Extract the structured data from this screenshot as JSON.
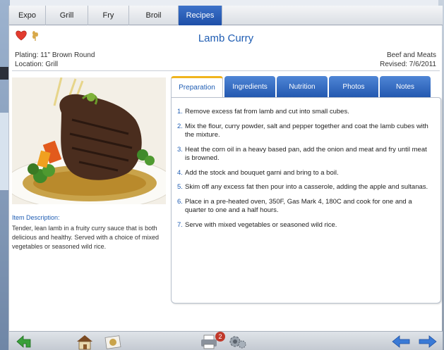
{
  "top_tabs": [
    {
      "label": "Expo"
    },
    {
      "label": "Grill"
    },
    {
      "label": "Fry"
    },
    {
      "label": "Broil"
    },
    {
      "label": "Recipes",
      "active": true
    }
  ],
  "recipe": {
    "title": "Lamb Curry",
    "plating": "Plating: 11\" Brown Round",
    "location": "Location: Grill",
    "category": "Beef and Meats",
    "revised": "Revised: 7/6/2011",
    "description_heading": "Item Description:",
    "description": "Tender, lean lamb in a fruity curry sauce that is both delicious and healthy. Served with a choice of mixed vegetables or seasoned wild rice."
  },
  "content_tabs": [
    {
      "label": "Preparation",
      "active": true
    },
    {
      "label": "Ingredients"
    },
    {
      "label": "Nutrition"
    },
    {
      "label": "Photos"
    },
    {
      "label": "Notes"
    }
  ],
  "steps": [
    {
      "num": "1.",
      "text": "Remove excess fat from lamb and cut into small cubes."
    },
    {
      "num": "2.",
      "text": "Mix the flour, curry powder, salt and pepper together  and coat the lamb cubes with the mixture."
    },
    {
      "num": "3.",
      "text": "Heat the corn oil in a heavy based pan, add the onion and meat and fry until meat is browned."
    },
    {
      "num": "4.",
      "text": "Add the stock and bouquet garni and bring to a boil."
    },
    {
      "num": "5.",
      "text": "Skim off any excess fat then pour into a casserole, adding the apple and sultanas."
    },
    {
      "num": "6.",
      "text": "Place in a pre-heated oven, 350F, Gas Mark 4, 180C and cook for one and a quarter to one and a half hours."
    },
    {
      "num": "7.",
      "text": "Serve with mixed vegetables or seasoned wild rice."
    }
  ],
  "toolbar": {
    "print_badge": "2"
  },
  "icons": {
    "favorite": "heart-icon",
    "dietary": "wheat-icon",
    "back": "return-arrow-icon",
    "home": "house-icon",
    "photo": "photo-icon",
    "print": "printer-icon",
    "settings": "gear-icon",
    "prev": "left-arrow-icon",
    "next": "right-arrow-icon"
  },
  "colors": {
    "accent": "#1f5db3",
    "tab_active_marker": "#f0b41e",
    "badge": "#c0392b"
  }
}
